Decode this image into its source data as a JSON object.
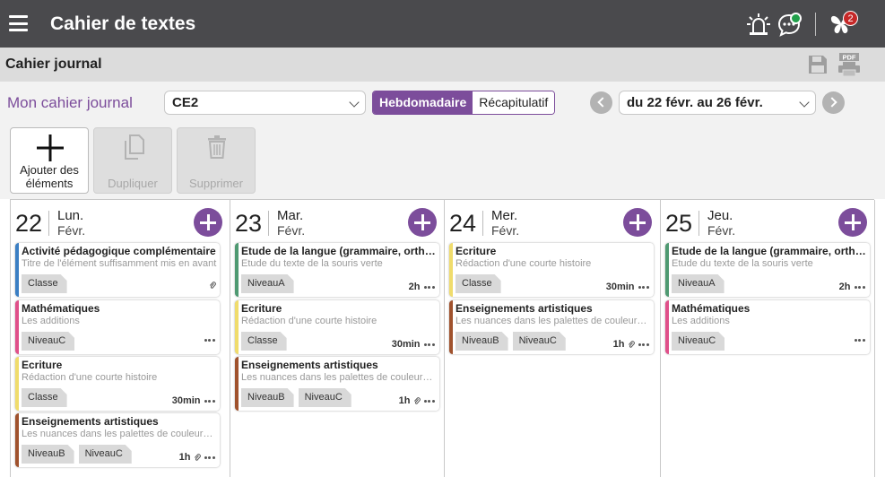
{
  "app": {
    "title": "Cahier de textes",
    "notification_count": "2"
  },
  "subheader": {
    "title": "Cahier journal"
  },
  "controls": {
    "label": "Mon cahier journal",
    "class_select": "CE2",
    "view_active": "Hebdomadaire",
    "view_other": "Récapitulatif",
    "period": "du 22 févr. au 26 févr."
  },
  "toolbar": {
    "add_label": "Ajouter des éléments",
    "duplicate_label": "Dupliquer",
    "delete_label": "Supprimer"
  },
  "colors": {
    "accent": "#7c4d9b",
    "topbar": "#4a4a4d",
    "subject_pedagogique": "#3b7fc4",
    "subject_maths": "#e0508a",
    "subject_ecriture": "#f0dc6c",
    "subject_arts": "#a0522d",
    "subject_langue": "#4f9a72"
  },
  "days": [
    {
      "num": "22",
      "name": "Lun.",
      "month": "Févr.",
      "cards": [
        {
          "title": "Activité pédagogique complémentaire",
          "subtitle": "Titre de l'élément suffisamment mis en avant",
          "tags": [
            "Classe"
          ],
          "duration": "",
          "attachment": true,
          "more": false,
          "color": "#3b7fc4"
        },
        {
          "title": "Mathématiques",
          "subtitle": "Les additions",
          "tags": [
            "NiveauC"
          ],
          "duration": "",
          "attachment": false,
          "more": true,
          "color": "#e0508a"
        },
        {
          "title": "Ecriture",
          "subtitle": "Rédaction d'une courte histoire",
          "tags": [
            "Classe"
          ],
          "duration": "30min",
          "attachment": false,
          "more": true,
          "color": "#f0dc6c"
        },
        {
          "title": "Enseignements artistiques",
          "subtitle": "Les nuances dans les palettes de couleurs de Van Gogh",
          "tags": [
            "NiveauB",
            "NiveauC"
          ],
          "duration": "1h",
          "attachment": true,
          "more": true,
          "color": "#a0522d"
        }
      ]
    },
    {
      "num": "23",
      "name": "Mar.",
      "month": "Févr.",
      "cards": [
        {
          "title": "Etude de la langue (grammaire, orthographe)",
          "subtitle": "Etude du texte de la souris verte",
          "tags": [
            "NiveauA"
          ],
          "duration": "2h",
          "attachment": false,
          "more": true,
          "color": "#4f9a72"
        },
        {
          "title": "Ecriture",
          "subtitle": "Rédaction d'une courte histoire",
          "tags": [
            "Classe"
          ],
          "duration": "30min",
          "attachment": false,
          "more": true,
          "color": "#f0dc6c"
        },
        {
          "title": "Enseignements artistiques",
          "subtitle": "Les nuances dans les palettes de couleurs de Van Gogh",
          "tags": [
            "NiveauB",
            "NiveauC"
          ],
          "duration": "1h",
          "attachment": true,
          "more": true,
          "color": "#a0522d"
        }
      ]
    },
    {
      "num": "24",
      "name": "Mer.",
      "month": "Févr.",
      "cards": [
        {
          "title": "Ecriture",
          "subtitle": "Rédaction d'une courte histoire",
          "tags": [
            "Classe"
          ],
          "duration": "30min",
          "attachment": false,
          "more": true,
          "color": "#f0dc6c"
        },
        {
          "title": "Enseignements artistiques",
          "subtitle": "Les nuances dans les palettes de couleurs de Van Gogh",
          "tags": [
            "NiveauB",
            "NiveauC"
          ],
          "duration": "1h",
          "attachment": true,
          "more": true,
          "color": "#a0522d"
        }
      ]
    },
    {
      "num": "25",
      "name": "Jeu.",
      "month": "Févr.",
      "cards": [
        {
          "title": "Etude de la langue (grammaire, orthographe)",
          "subtitle": "Etude du texte de la souris verte",
          "tags": [
            "NiveauA"
          ],
          "duration": "2h",
          "attachment": false,
          "more": true,
          "color": "#4f9a72"
        },
        {
          "title": "Mathématiques",
          "subtitle": "Les additions",
          "tags": [
            "NiveauC"
          ],
          "duration": "",
          "attachment": false,
          "more": true,
          "color": "#e0508a"
        }
      ]
    }
  ]
}
